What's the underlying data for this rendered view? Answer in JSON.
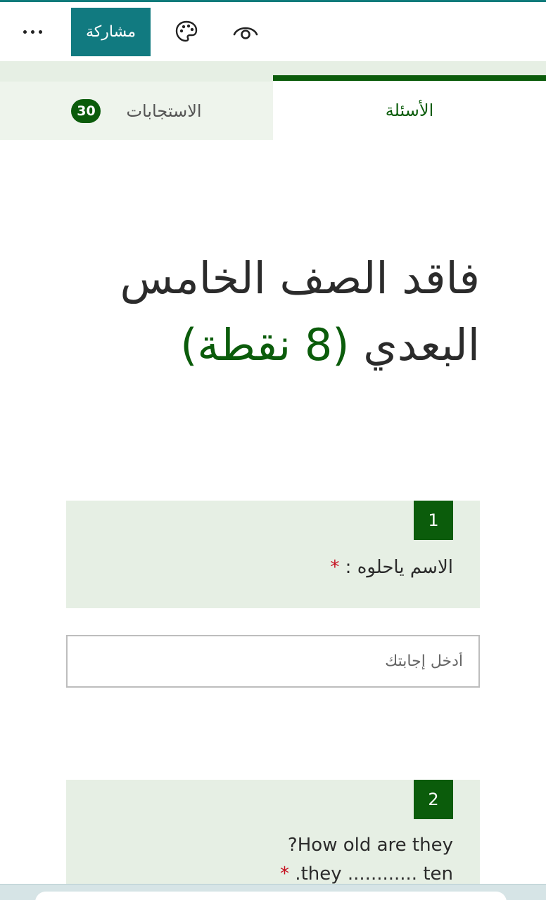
{
  "toolbar": {
    "more_icon": "more-horizontal-icon",
    "share_label": "مشاركة",
    "theme_icon": "palette-icon",
    "preview_icon": "eye-icon",
    "accent": "#117a80"
  },
  "tabs": {
    "questions_label": "الأسئلة",
    "responses_label": "الاستجابات",
    "responses_count": "30",
    "active": "questions",
    "accent": "#0b5c0b"
  },
  "form": {
    "title_line1": "فاقد الصف الخامس",
    "title_line2": "البعدي",
    "points": "(8 نقطة)"
  },
  "questions": [
    {
      "number": "1",
      "text": "الاسم ياحلوه :",
      "required": "*",
      "answer_placeholder": "أدخل إجابتك"
    },
    {
      "number": "2",
      "text_line1": "How old are they?",
      "text_line2": "they ............ ten.",
      "required": "*"
    }
  ]
}
